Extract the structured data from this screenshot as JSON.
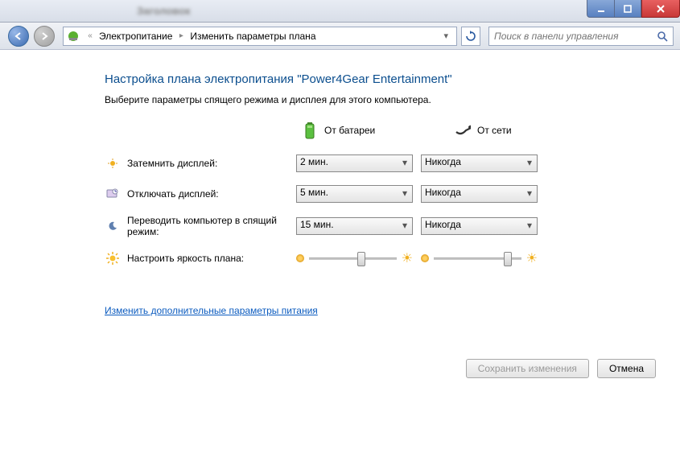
{
  "titlebar": {
    "title_blurred": "Заголовок"
  },
  "nav": {
    "breadcrumb_prefix": "«",
    "section": "Электропитание",
    "page": "Изменить параметры плана"
  },
  "search": {
    "placeholder": "Поиск в панели управления"
  },
  "heading": "Настройка плана электропитания \"Power4Gear Entertainment\"",
  "subheading": "Выберите параметры спящего режима и дисплея для этого компьютера.",
  "columns": {
    "battery": "От батареи",
    "ac": "От сети"
  },
  "rows": {
    "dim": {
      "label": "Затемнить дисплей:",
      "battery": "2 мин.",
      "ac": "Никогда"
    },
    "display": {
      "label": "Отключать дисплей:",
      "battery": "5 мин.",
      "ac": "Никогда"
    },
    "sleep": {
      "label": "Переводить компьютер в спящий режим:",
      "battery": "15 мин.",
      "ac": "Никогда"
    },
    "bright": {
      "label": "Настроить яркость плана:",
      "battery_pos_pct": 55,
      "ac_pos_pct": 80
    }
  },
  "link": "Изменить дополнительные параметры питания",
  "buttons": {
    "save": "Сохранить изменения",
    "cancel": "Отмена"
  }
}
